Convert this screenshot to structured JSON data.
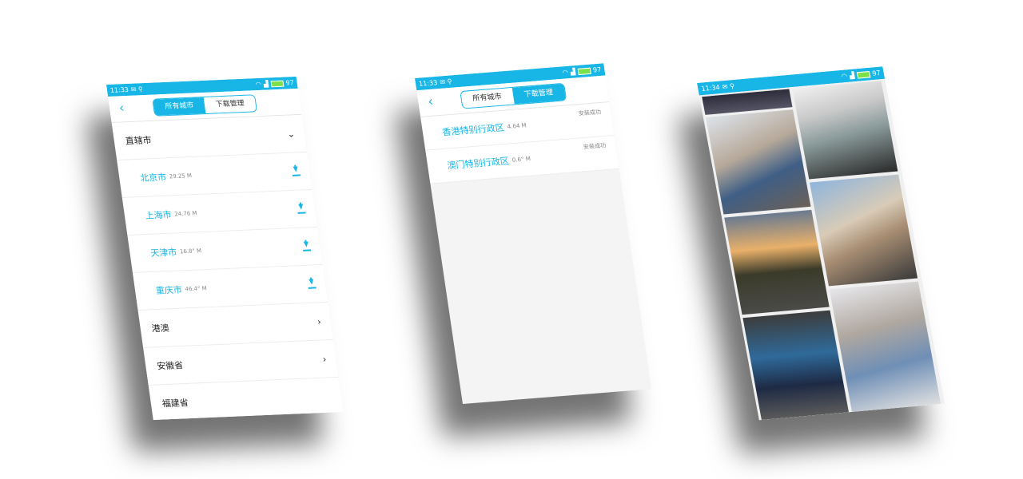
{
  "status_bar": {
    "screen1_time": "11:33",
    "screen2_time": "11:33",
    "screen3_time": "11:34",
    "battery": "97"
  },
  "tabs": {
    "all_cities": "所有城市",
    "download_manager": "下载管理"
  },
  "screen1": {
    "sections": [
      {
        "label": "直辖市",
        "expanded": true
      },
      {
        "label": "港澳"
      },
      {
        "label": "安徽省"
      },
      {
        "label": "福建省"
      }
    ],
    "cities": [
      {
        "name": "北京市",
        "size": "29.25 M"
      },
      {
        "name": "上海市",
        "size": "24.76 M"
      },
      {
        "name": "天津市",
        "size": "16.8° M"
      },
      {
        "name": "重庆市",
        "size": "46.4° M"
      }
    ]
  },
  "screen2": {
    "items": [
      {
        "name": "香港特别行政区",
        "size": "4.64 M",
        "status": "安装成功"
      },
      {
        "name": "澳门特别行政区",
        "size": "0.6° M",
        "status": "安装成功"
      }
    ]
  },
  "colors": {
    "accent": "#17b6e6",
    "background": "#ffffff",
    "text": "#222222",
    "muted": "#888888"
  },
  "icons": [
    "back-icon",
    "chevron-down-icon",
    "download-icon",
    "chevron-right-icon",
    "wifi-icon",
    "signal-icon",
    "battery-icon"
  ]
}
